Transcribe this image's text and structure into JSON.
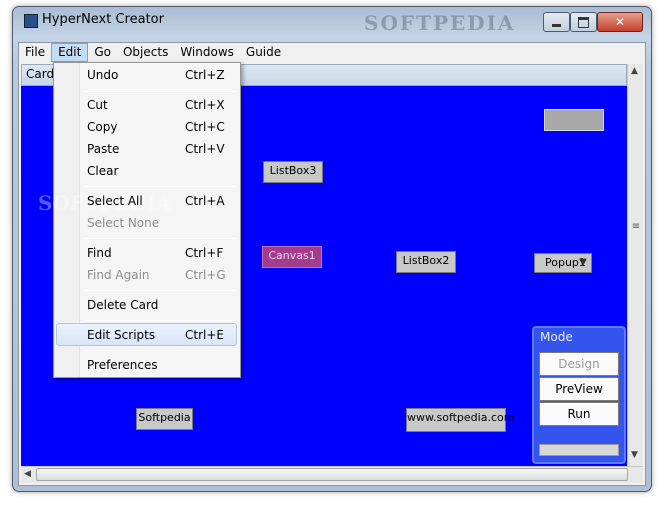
{
  "window": {
    "title": "HyperNext Creator",
    "watermark": "SOFTPEDIA"
  },
  "menubar": {
    "items": [
      "File",
      "Edit",
      "Go",
      "Objects",
      "Windows",
      "Guide"
    ]
  },
  "card": {
    "label": "Card"
  },
  "widgets": {
    "listbox3": "ListBox3",
    "canvas1": "Canvas1",
    "listbox2": "ListBox2",
    "popup1": "Popup1",
    "softpedia": "Softpedia",
    "www": "www.softpedia.com"
  },
  "mode_panel": {
    "title": "Mode",
    "buttons": [
      "Design",
      "PreView",
      "Run"
    ]
  },
  "edit_menu": {
    "items": [
      {
        "label": "Undo",
        "shortcut": "Ctrl+Z",
        "enabled": true
      },
      {
        "label": "Cut",
        "shortcut": "Ctrl+X",
        "enabled": true
      },
      {
        "label": "Copy",
        "shortcut": "Ctrl+C",
        "enabled": true
      },
      {
        "label": "Paste",
        "shortcut": "Ctrl+V",
        "enabled": true
      },
      {
        "label": "Clear",
        "shortcut": "",
        "enabled": true
      },
      {
        "label": "Select All",
        "shortcut": "Ctrl+A",
        "enabled": true
      },
      {
        "label": "Select None",
        "shortcut": "",
        "enabled": false
      },
      {
        "label": "Find",
        "shortcut": "Ctrl+F",
        "enabled": true
      },
      {
        "label": "Find Again",
        "shortcut": "Ctrl+G",
        "enabled": false
      },
      {
        "label": "Delete Card",
        "shortcut": "",
        "enabled": true
      },
      {
        "label": "Edit Scripts",
        "shortcut": "Ctrl+E",
        "enabled": true
      },
      {
        "label": "Preferences",
        "shortcut": "",
        "enabled": true
      }
    ],
    "highlighted": "Edit Scripts",
    "watermark": "SOFTPEDIA"
  },
  "colors": {
    "canvas": "#0000ff",
    "canvas1_widget": "#a23d8e",
    "mode_panel": "#3355ee"
  }
}
